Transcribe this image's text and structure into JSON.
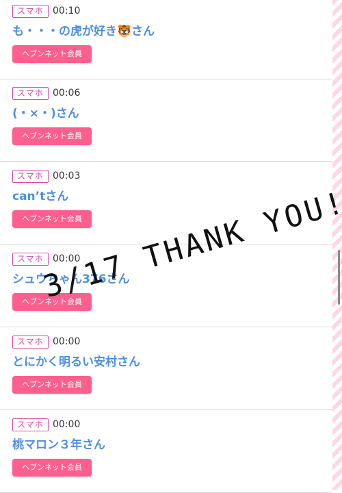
{
  "entries": [
    {
      "badge": "スマホ",
      "time": "00:10",
      "name": "も・・・の虎が好き🐯さん",
      "member_label": "ヘブンネット会員"
    },
    {
      "badge": "スマホ",
      "time": "00:06",
      "name": "(・×・)さん",
      "member_label": "ヘブンネット会員"
    },
    {
      "badge": "スマホ",
      "time": "00:03",
      "name": "can’tさん",
      "member_label": "ヘブンネット会員"
    },
    {
      "badge": "スマホ",
      "time": "00:00",
      "name": "シュウちゃん376さん",
      "member_label": "ヘブンネット会員"
    },
    {
      "badge": "スマホ",
      "time": "00:00",
      "name": "とにかく明るい安村さん",
      "member_label": "ヘブンネット会員"
    },
    {
      "badge": "スマホ",
      "time": "00:00",
      "name": "桃マロン３年さん",
      "member_label": "ヘブンネット会員"
    }
  ],
  "overlay_text": "3/17 THANK YOU!",
  "colors": {
    "badge": "#d64aa6",
    "name": "#4f8fdc",
    "button": "#ff5f8f",
    "divider": "#d6d6d6"
  }
}
